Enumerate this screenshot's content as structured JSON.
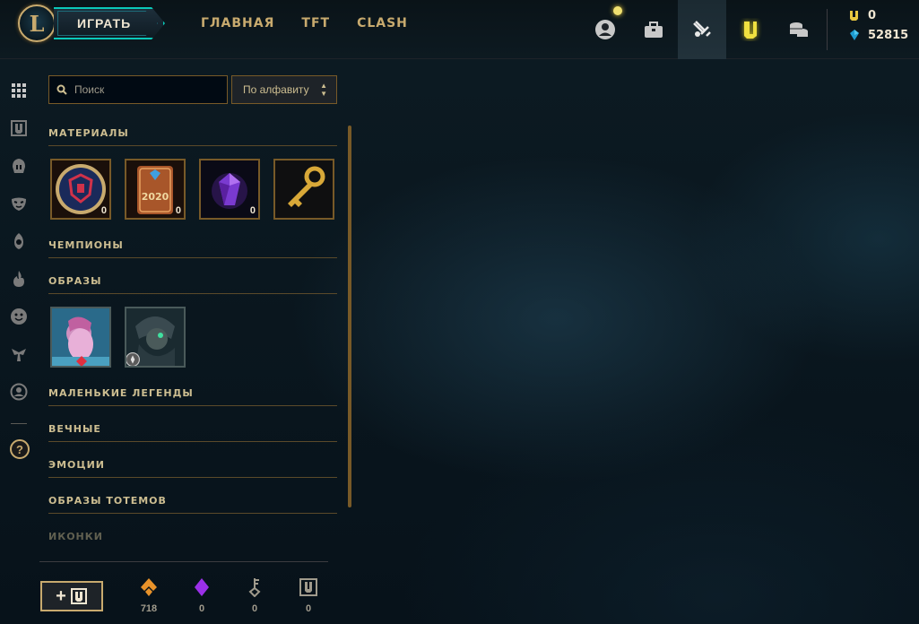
{
  "header": {
    "play_label": "ИГРАТЬ",
    "nav": [
      "ГЛАВНАЯ",
      "TFT",
      "CLASH"
    ],
    "icons": [
      "profile-icon",
      "collection-icon",
      "loot-icon",
      "store-icon",
      "wallet-icon"
    ],
    "currency": {
      "riot_points": "0",
      "blue_essence": "52815"
    }
  },
  "rail_icons": [
    "grid-icon",
    "champions-icon",
    "skins-icon",
    "emotes-icon",
    "ward-icon",
    "spells-icon",
    "icons-icon",
    "runes-icon",
    "profile-icon"
  ],
  "search": {
    "placeholder": "Поиск"
  },
  "sort": {
    "label": "По алфавиту"
  },
  "sections": {
    "materials": "МАТЕРИАЛЫ",
    "champions": "ЧЕМПИОНЫ",
    "skins": "ОБРАЗЫ",
    "little_legends": "МАЛЕНЬКИЕ ЛЕГЕНДЫ",
    "eternals": "ВЕЧНЫЕ",
    "emotes": "ЭМОЦИИ",
    "totems": "ОБРАЗЫ ТОТЕМОВ",
    "icons": "ИКОНКИ"
  },
  "materials": [
    {
      "icon": "worlds-capsule-icon",
      "count": "0"
    },
    {
      "icon": "2020-chest-icon",
      "count": "0"
    },
    {
      "icon": "gemstone-icon",
      "count": "0"
    },
    {
      "icon": "key-fragment-icon",
      "count": ""
    }
  ],
  "material_2020_text": "2020",
  "skins": [
    {
      "icon": "skin-1-icon",
      "badge": "ruby-badge-icon"
    },
    {
      "icon": "skin-2-icon",
      "badge": "skin-badge-icon"
    }
  ],
  "footer": {
    "add_label": "+",
    "stats": [
      {
        "icon": "orange-essence-icon",
        "value": "718",
        "color": "#e8922a"
      },
      {
        "icon": "gemstone-icon",
        "value": "0",
        "color": "#9b30e8"
      },
      {
        "icon": "key-icon",
        "value": "0",
        "color": "#a09b8c"
      },
      {
        "icon": "token-icon",
        "value": "0",
        "color": "#a09b8c"
      }
    ]
  },
  "colors": {
    "gold": "#c8aa6e",
    "teal": "#0ac8b9",
    "bg": "#0a1117"
  }
}
